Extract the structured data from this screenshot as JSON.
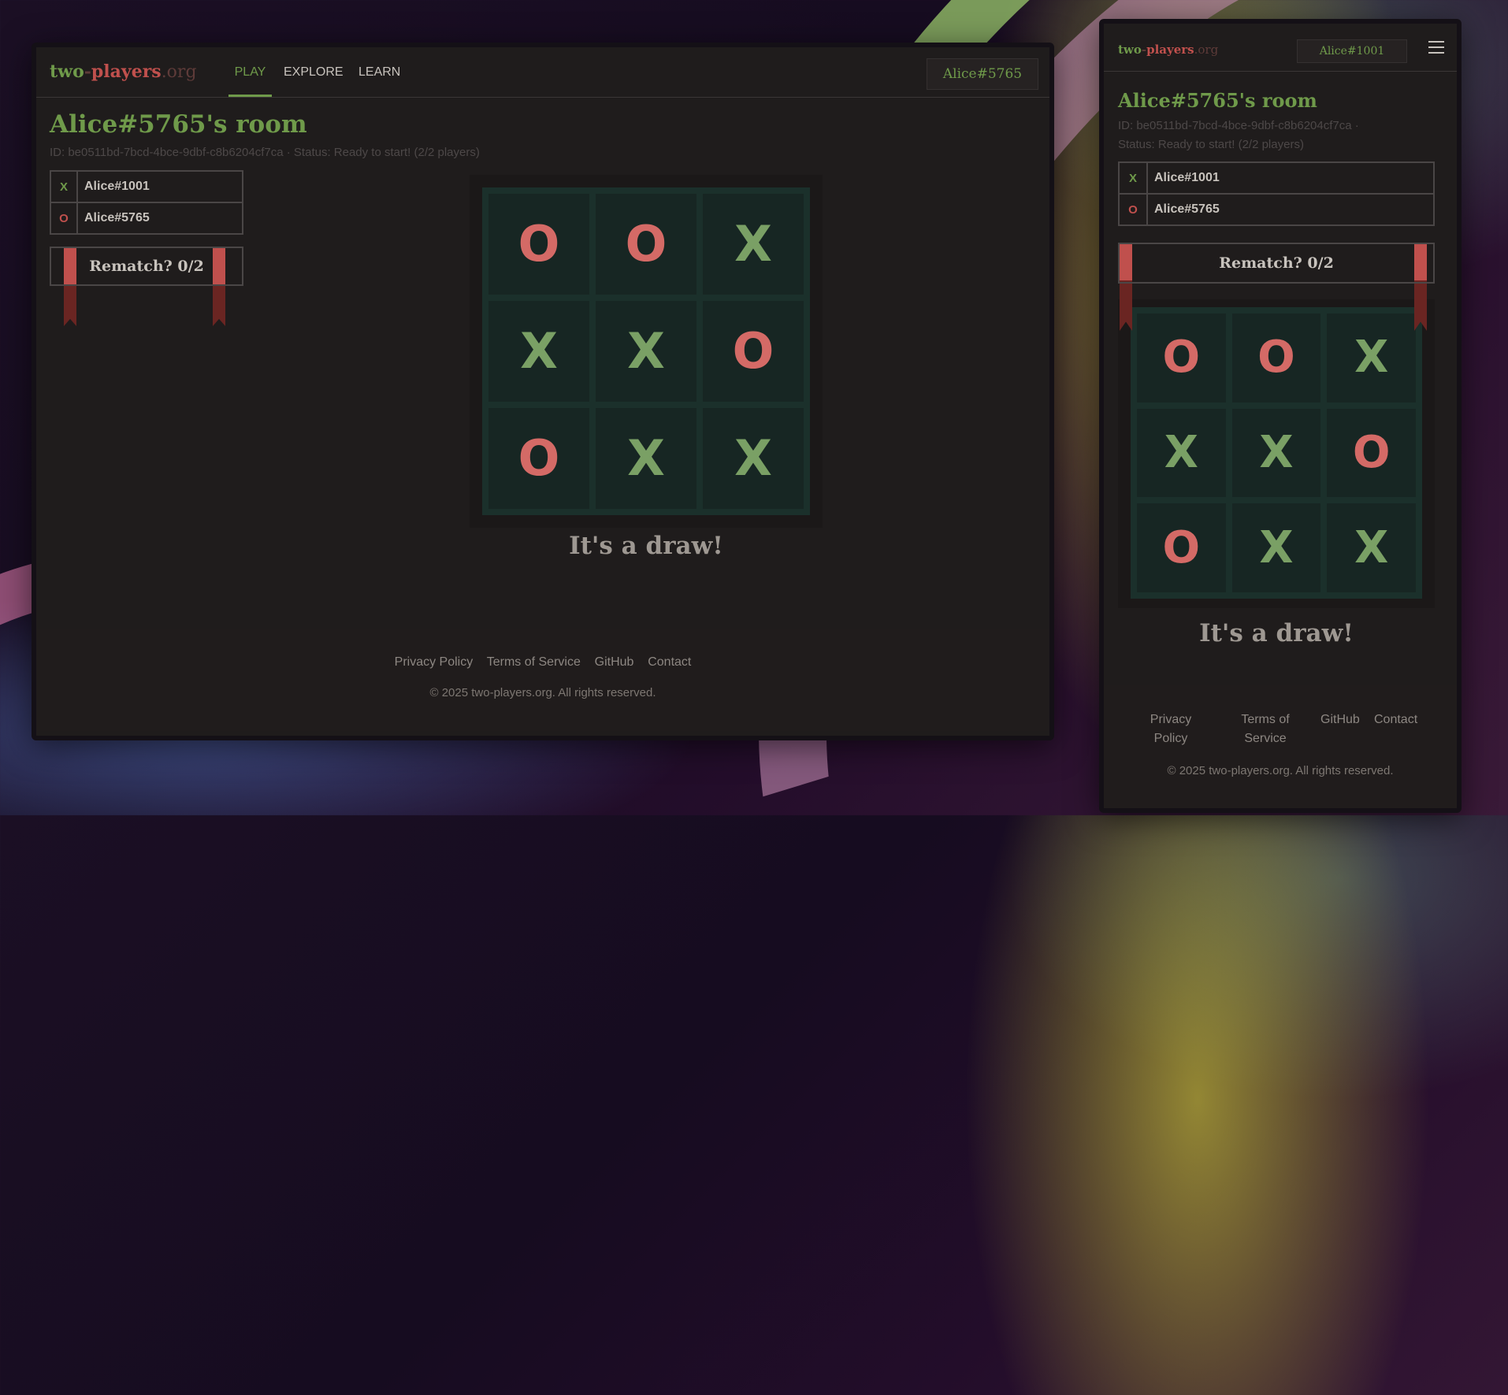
{
  "site": {
    "logo": {
      "part1": "two",
      "sep1": "-",
      "part2": "players",
      "part3": ".org"
    }
  },
  "desktop": {
    "nav": {
      "play": "PLAY",
      "explore": "EXPLORE",
      "learn": "LEARN"
    },
    "user": "Alice#5765"
  },
  "mobile": {
    "user": "Alice#1001"
  },
  "room": {
    "title": "Alice#5765's room",
    "id_line": "ID: be0511bd-7bcd-4bce-9dbf-c8b6204cf7ca · Status: Ready to start! (2/2 players)",
    "id_line_mobile_1": "ID: be0511bd-7bcd-4bce-9dbf-c8b6204cf7ca ·",
    "id_line_mobile_2": "Status: Ready to start! (2/2 players)",
    "players": [
      {
        "mark": "X",
        "name": "Alice#1001"
      },
      {
        "mark": "O",
        "name": "Alice#5765"
      }
    ],
    "rematch_label": "Rematch? 0/2",
    "result": "It's a draw!"
  },
  "board": {
    "cells": [
      "O",
      "O",
      "X",
      "X",
      "X",
      "O",
      "O",
      "X",
      "X"
    ]
  },
  "footer": {
    "privacy": "Privacy Policy",
    "privacy_1": "Privacy",
    "privacy_2": "Policy",
    "terms": "Terms of Service",
    "terms_1": "Terms of",
    "terms_2": "Service",
    "github": "GitHub",
    "contact": "Contact",
    "copyright": "© 2025 two-players.org. All rights reserved."
  },
  "colors": {
    "accent_green": "#6f9a4a",
    "accent_red": "#c0504d",
    "x_mark": "#7aa065",
    "o_mark": "#d46a66",
    "board_bg": "#172623"
  }
}
